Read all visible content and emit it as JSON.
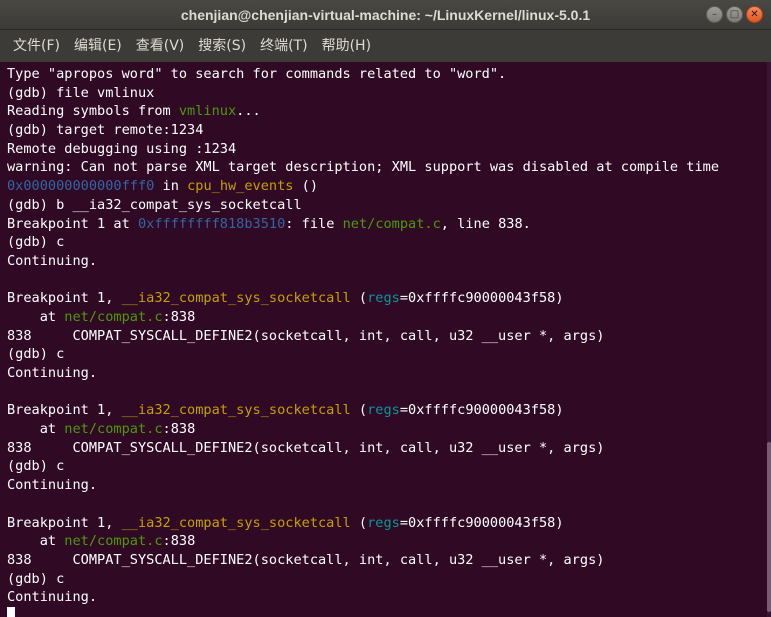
{
  "window": {
    "title": "chenjian@chenjian-virtual-machine: ~/LinuxKernel/linux-5.0.1",
    "buttons": {
      "minimize_glyph": "–",
      "maximize_glyph": "□",
      "close_glyph": "✕"
    }
  },
  "menu": {
    "items": [
      {
        "label": "文件(F)",
        "name": "menu-file"
      },
      {
        "label": "编辑(E)",
        "name": "menu-edit"
      },
      {
        "label": "查看(V)",
        "name": "menu-view"
      },
      {
        "label": "搜索(S)",
        "name": "menu-search"
      },
      {
        "label": "终端(T)",
        "name": "menu-terminal"
      },
      {
        "label": "帮助(H)",
        "name": "menu-help"
      }
    ]
  },
  "colors": {
    "background": "#300a24",
    "text": "#ffffff",
    "function_name": "#c4a000",
    "file_path": "#4e9a06",
    "address": "#3465a4",
    "param_name": "#06989a"
  },
  "terminal": {
    "lines": [
      [
        {
          "t": "Type \"apropos word\" to search for commands related to \"word\".",
          "c": "normal"
        }
      ],
      [
        {
          "t": "(gdb) file vmlinux",
          "c": "normal"
        }
      ],
      [
        {
          "t": "Reading symbols from ",
          "c": "normal"
        },
        {
          "t": "vmlinux",
          "c": "green"
        },
        {
          "t": "...",
          "c": "normal"
        }
      ],
      [
        {
          "t": "(gdb) target remote:1234",
          "c": "normal"
        }
      ],
      [
        {
          "t": "Remote debugging using :1234",
          "c": "normal"
        }
      ],
      [
        {
          "t": "warning: Can not parse XML target description; XML support was disabled at compile time",
          "c": "normal"
        }
      ],
      [
        {
          "t": "0x000000000000fff0",
          "c": "blue"
        },
        {
          "t": " in ",
          "c": "normal"
        },
        {
          "t": "cpu_hw_events",
          "c": "yellow"
        },
        {
          "t": " ()",
          "c": "normal"
        }
      ],
      [
        {
          "t": "(gdb) b __ia32_compat_sys_socketcall",
          "c": "normal"
        }
      ],
      [
        {
          "t": "Breakpoint 1 at ",
          "c": "normal"
        },
        {
          "t": "0xffffffff818b3510",
          "c": "blue"
        },
        {
          "t": ": file ",
          "c": "normal"
        },
        {
          "t": "net/compat.c",
          "c": "green"
        },
        {
          "t": ", line 838.",
          "c": "normal"
        }
      ],
      [
        {
          "t": "(gdb) c",
          "c": "normal"
        }
      ],
      [
        {
          "t": "Continuing.",
          "c": "normal"
        }
      ],
      [
        {
          "t": "",
          "c": "normal"
        }
      ],
      [
        {
          "t": "Breakpoint 1, ",
          "c": "normal"
        },
        {
          "t": "__ia32_compat_sys_socketcall",
          "c": "yellow"
        },
        {
          "t": " (",
          "c": "normal"
        },
        {
          "t": "regs",
          "c": "cyan"
        },
        {
          "t": "=0xffffc90000043f58)",
          "c": "normal"
        }
      ],
      [
        {
          "t": "    at ",
          "c": "normal"
        },
        {
          "t": "net/compat.c",
          "c": "green"
        },
        {
          "t": ":838",
          "c": "normal"
        }
      ],
      [
        {
          "t": "838     COMPAT_SYSCALL_DEFINE2(socketcall, int, call, u32 __user *, args)",
          "c": "normal"
        }
      ],
      [
        {
          "t": "(gdb) c",
          "c": "normal"
        }
      ],
      [
        {
          "t": "Continuing.",
          "c": "normal"
        }
      ],
      [
        {
          "t": "",
          "c": "normal"
        }
      ],
      [
        {
          "t": "Breakpoint 1, ",
          "c": "normal"
        },
        {
          "t": "__ia32_compat_sys_socketcall",
          "c": "yellow"
        },
        {
          "t": " (",
          "c": "normal"
        },
        {
          "t": "regs",
          "c": "cyan"
        },
        {
          "t": "=0xffffc90000043f58)",
          "c": "normal"
        }
      ],
      [
        {
          "t": "    at ",
          "c": "normal"
        },
        {
          "t": "net/compat.c",
          "c": "green"
        },
        {
          "t": ":838",
          "c": "normal"
        }
      ],
      [
        {
          "t": "838     COMPAT_SYSCALL_DEFINE2(socketcall, int, call, u32 __user *, args)",
          "c": "normal"
        }
      ],
      [
        {
          "t": "(gdb) c",
          "c": "normal"
        }
      ],
      [
        {
          "t": "Continuing.",
          "c": "normal"
        }
      ],
      [
        {
          "t": "",
          "c": "normal"
        }
      ],
      [
        {
          "t": "Breakpoint 1, ",
          "c": "normal"
        },
        {
          "t": "__ia32_compat_sys_socketcall",
          "c": "yellow"
        },
        {
          "t": " (",
          "c": "normal"
        },
        {
          "t": "regs",
          "c": "cyan"
        },
        {
          "t": "=0xffffc90000043f58)",
          "c": "normal"
        }
      ],
      [
        {
          "t": "    at ",
          "c": "normal"
        },
        {
          "t": "net/compat.c",
          "c": "green"
        },
        {
          "t": ":838",
          "c": "normal"
        }
      ],
      [
        {
          "t": "838     COMPAT_SYSCALL_DEFINE2(socketcall, int, call, u32 __user *, args)",
          "c": "normal"
        }
      ],
      [
        {
          "t": "(gdb) c",
          "c": "normal"
        }
      ],
      [
        {
          "t": "Continuing.",
          "c": "normal"
        }
      ]
    ]
  }
}
